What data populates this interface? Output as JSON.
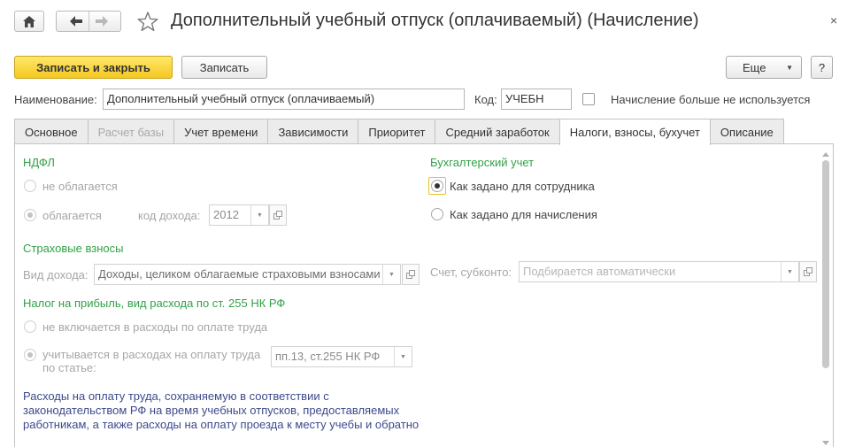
{
  "window": {
    "title": "Дополнительный учебный отпуск (оплачиваемый) (Начисление)",
    "close_glyph": "×"
  },
  "toolbar": {
    "save_close_label": "Записать и закрыть",
    "save_label": "Записать",
    "more_label": "Еще",
    "help_label": "?"
  },
  "header": {
    "name_label": "Наименование:",
    "name_value": "Дополнительный учебный отпуск (оплачиваемый)",
    "code_label": "Код:",
    "code_value": "УЧЕБН",
    "unused_label": "Начисление больше не используется",
    "unused_checked": false
  },
  "tabs": [
    {
      "label": "Основное",
      "state": "normal"
    },
    {
      "label": "Расчет базы",
      "state": "disabled"
    },
    {
      "label": "Учет времени",
      "state": "normal"
    },
    {
      "label": "Зависимости",
      "state": "normal"
    },
    {
      "label": "Приоритет",
      "state": "normal"
    },
    {
      "label": "Средний заработок",
      "state": "normal"
    },
    {
      "label": "Налоги, взносы, бухучет",
      "state": "active"
    },
    {
      "label": "Описание",
      "state": "normal"
    }
  ],
  "ndfl": {
    "title": "НДФЛ",
    "option_not_taxed": "не облагается",
    "option_taxed": "облагается",
    "income_code_label": "код дохода:",
    "income_code_value": "2012",
    "selected": "taxed"
  },
  "insurance": {
    "title": "Страховые взносы",
    "income_type_label": "Вид дохода:",
    "income_type_value": "Доходы, целиком облагаемые страховыми взносами"
  },
  "profit_tax": {
    "title": "Налог на прибыль, вид расхода по ст. 255 НК РФ",
    "option_not_included": "не включается в расходы по оплате труда",
    "option_included_line1": "учитывается в расходах на оплату труда",
    "option_included_line2": "по статье:",
    "article_value": "пп.13, ст.255 НК РФ",
    "selected": "included"
  },
  "accounting": {
    "title": "Бухгалтерский учет",
    "option_employee": "Как задано для сотрудника",
    "option_accrual": "Как задано для начисления",
    "selected": "employee",
    "account_label": "Счет, субконто:",
    "account_placeholder": "Подбирается автоматически"
  },
  "description": {
    "line1": "Расходы на оплату труда, сохраняемую в соответствии с",
    "line2": "законодательством РФ на время учебных отпусков, предоставляемых",
    "line3": "работникам, а также расходы на оплату проезда к месту учебы и обратно"
  },
  "colors": {
    "accent_green": "#31a147",
    "primary_button": "#f5c821",
    "note_blue": "#3d4a8c"
  }
}
